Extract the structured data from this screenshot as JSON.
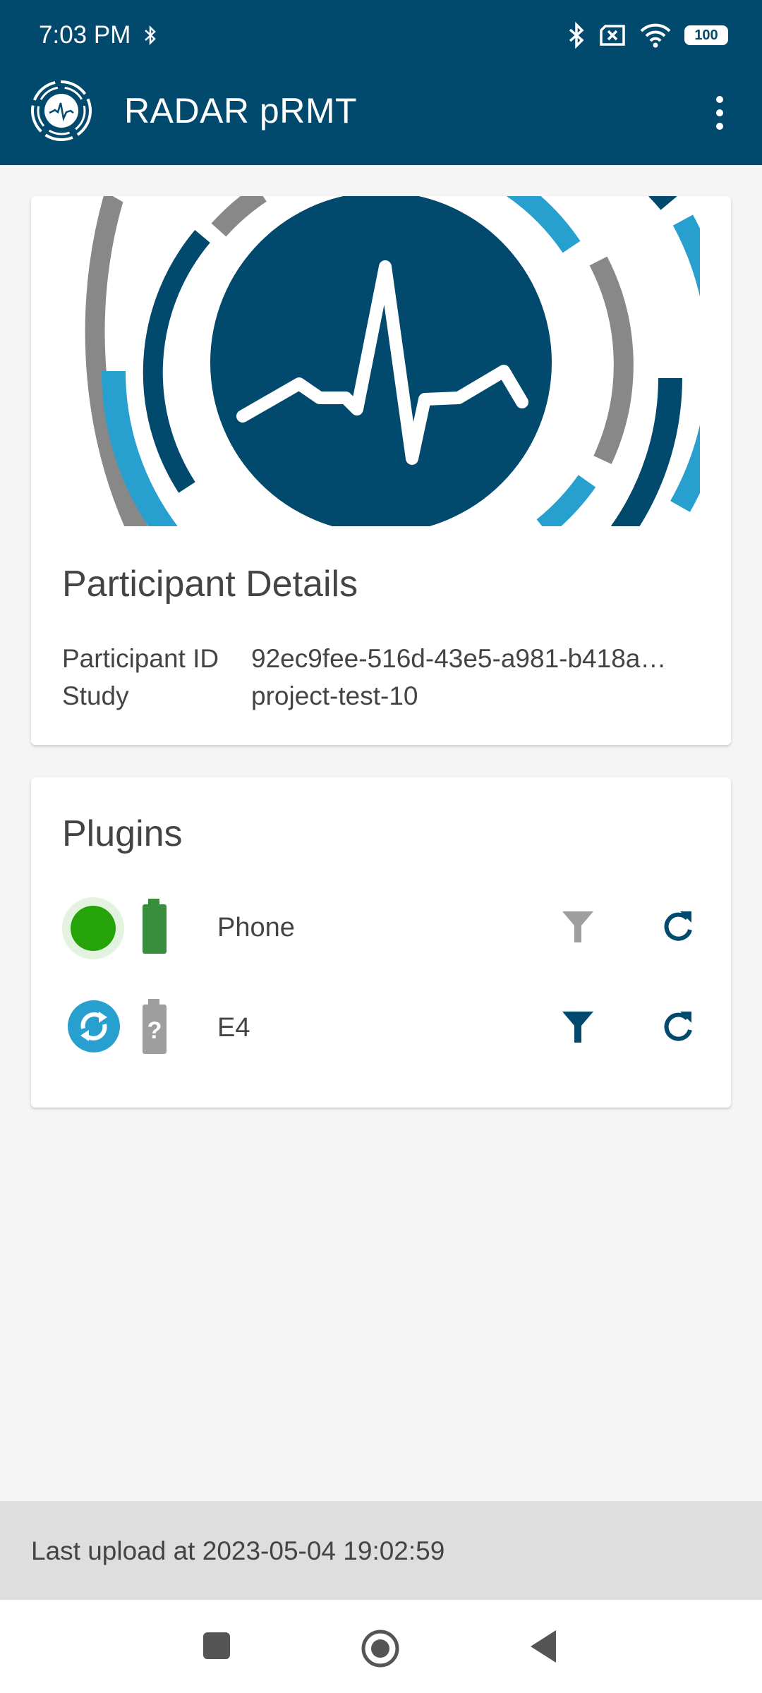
{
  "status_bar": {
    "time": "7:03 PM",
    "battery_level": "100"
  },
  "app_bar": {
    "title": "RADAR pRMT"
  },
  "participant_card": {
    "title": "Participant Details",
    "rows": [
      {
        "label": "Participant ID",
        "value": "92ec9fee-516d-43e5-a981-b418a…"
      },
      {
        "label": "Study",
        "value": "project-test-10"
      }
    ]
  },
  "plugins_card": {
    "title": "Plugins",
    "plugins": [
      {
        "name": "Phone",
        "status": "connected",
        "battery": "charged"
      },
      {
        "name": "E4",
        "status": "syncing",
        "battery": "unknown"
      }
    ]
  },
  "footer": {
    "last_upload": "Last upload at 2023-05-04 19:02:59"
  },
  "colors": {
    "primary": "#024a6d",
    "accent_blue": "#27a0d0",
    "status_green": "#27a30a",
    "gray_arc": "#888888"
  }
}
